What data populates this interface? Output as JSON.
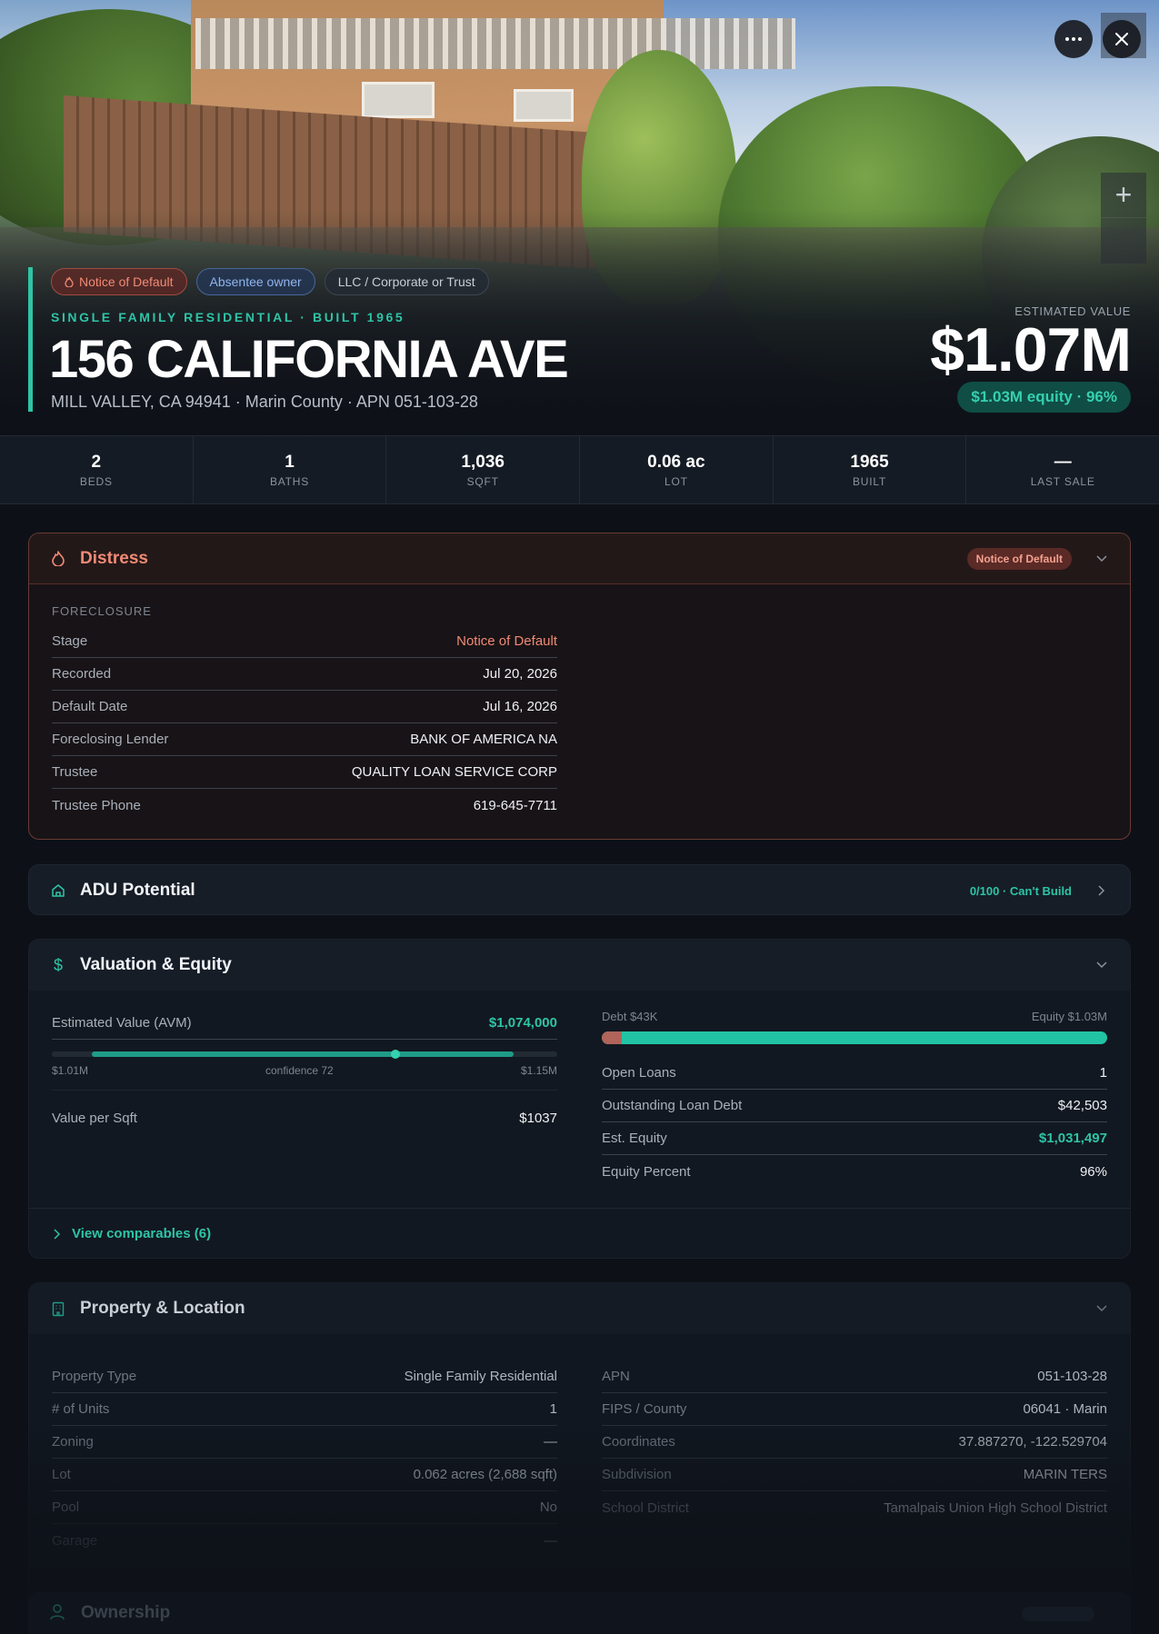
{
  "hero": {
    "tags": {
      "nod": "Notice of Default",
      "absentee": "Absentee owner",
      "llc": "LLC / Corporate or Trust"
    },
    "subtitle": "SINGLE FAMILY RESIDENTIAL · BUILT 1965",
    "address": "156 CALIFORNIA AVE",
    "location_line": "MILL VALLEY, CA 94941 · Marin County · APN 051-103-28",
    "estimated_label": "ESTIMATED VALUE",
    "estimated_value": "$1.07M",
    "equity_pill": "$1.03M equity · 96%"
  },
  "stats": [
    {
      "value": "2",
      "label": "BEDS"
    },
    {
      "value": "1",
      "label": "BATHS"
    },
    {
      "value": "1,036",
      "label": "SQFT"
    },
    {
      "value": "0.06 ac",
      "label": "LOT"
    },
    {
      "value": "1965",
      "label": "BUILT"
    },
    {
      "value": "—",
      "label": "LAST SALE"
    }
  ],
  "distress": {
    "title": "Distress",
    "badge": "Notice of Default",
    "section": "FORECLOSURE",
    "rows": [
      {
        "k": "Stage",
        "v": "Notice of Default"
      },
      {
        "k": "Recorded",
        "v": "Jul 20, 2026"
      },
      {
        "k": "Default Date",
        "v": "Jul 16, 2026"
      },
      {
        "k": "Foreclosing Lender",
        "v": "BANK OF AMERICA NA"
      },
      {
        "k": "Trustee",
        "v": "QUALITY LOAN SERVICE CORP"
      },
      {
        "k": "Trustee Phone",
        "v": "619-645-7711"
      }
    ]
  },
  "adu": {
    "title": "ADU Potential",
    "score": "0/100 · Can't Build"
  },
  "valuation": {
    "title": "Valuation & Equity",
    "avm_label": "Estimated Value (AVM)",
    "avm_value": "$1,074,000",
    "range_low": "$1.01M",
    "range_high": "$1.15M",
    "confidence": "confidence 72",
    "confidence_value": 72,
    "per_sqft_label": "Value per Sqft",
    "per_sqft_value": "$1037",
    "debt_label": "Debt $43K",
    "equity_label": "Equity $1.03M",
    "equity_fraction": 0.96,
    "rows": [
      {
        "k": "Open Loans",
        "v": "1"
      },
      {
        "k": "Outstanding Loan Debt",
        "v": "$42,503"
      },
      {
        "k": "Est. Equity",
        "v": "$1,031,497"
      },
      {
        "k": "Equity Percent",
        "v": "96%"
      }
    ],
    "comparables": "View comparables (6)"
  },
  "property": {
    "title": "Property & Location",
    "left": [
      {
        "k": "Property Type",
        "v": "Single Family Residential"
      },
      {
        "k": "# of Units",
        "v": "1"
      },
      {
        "k": "Zoning",
        "v": "—"
      },
      {
        "k": "Lot",
        "v": "0.062 acres (2,688 sqft)"
      },
      {
        "k": "Pool",
        "v": "No"
      },
      {
        "k": "Garage",
        "v": "—"
      }
    ],
    "right": [
      {
        "k": "APN",
        "v": "051-103-28"
      },
      {
        "k": "FIPS / County",
        "v": "06041 · Marin"
      },
      {
        "k": "Coordinates",
        "v": "37.887270, -122.529704"
      },
      {
        "k": "Subdivision",
        "v": "MARIN TERS"
      },
      {
        "k": "School District",
        "v": "Tamalpais Union High School District"
      }
    ]
  },
  "ownership": {
    "title": "Ownership"
  },
  "colors": {
    "accent": "#2ec4a6",
    "distress": "#f08a75",
    "debt": "#b0645a"
  },
  "icons": {
    "more": "more-horizontal-icon",
    "close": "close-icon",
    "zoom": "plus-icon",
    "distress": "flame-icon",
    "adu": "home-icon",
    "valuation": "dollar-icon",
    "property": "building-icon",
    "chevron_down": "chevron-down-icon",
    "chevron_right": "chevron-right-icon"
  }
}
